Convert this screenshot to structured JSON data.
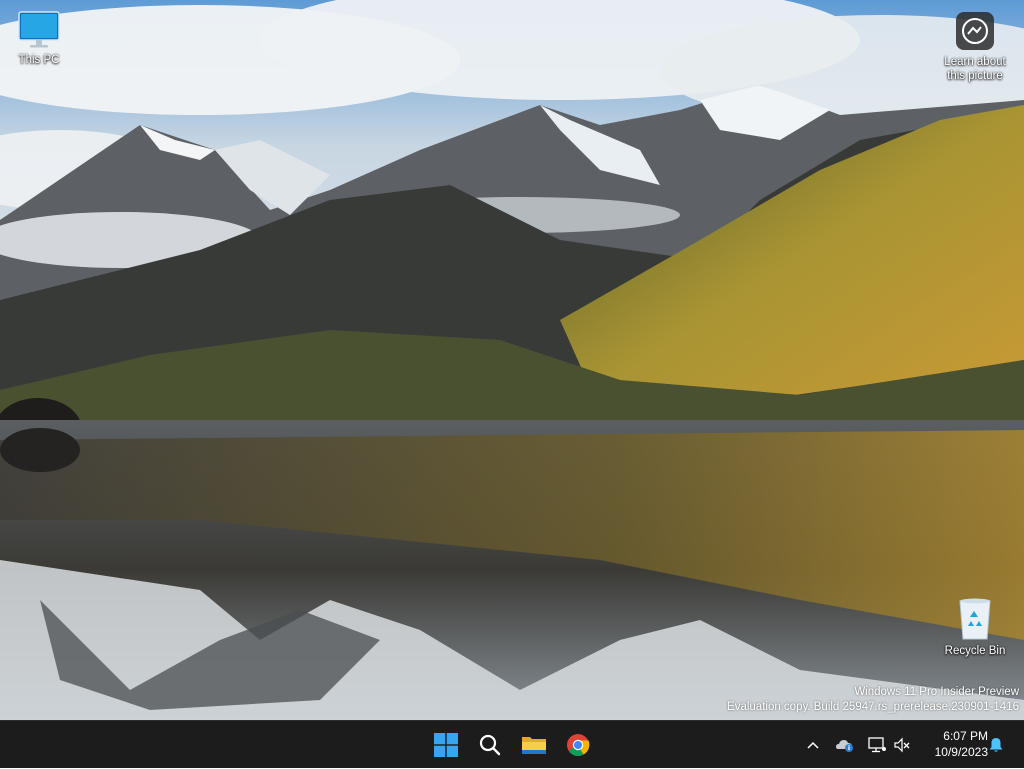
{
  "desktop": {
    "icons": [
      {
        "label": "This PC",
        "icon": "monitor-icon"
      },
      {
        "label_line1": "Learn about",
        "label_line2": "this picture",
        "icon": "camera-info-icon"
      },
      {
        "label": "Recycle Bin",
        "icon": "recycle-bin-icon"
      }
    ],
    "watermark": {
      "line1": "Windows 11 Pro Insider Preview",
      "line2": "Evaluation copy. Build 25947.rs_prerelease.230901-1416"
    }
  },
  "taskbar": {
    "apps": [
      {
        "icon": "windows-start-icon",
        "color": "#38a5f0"
      },
      {
        "icon": "search-icon",
        "color": "#ffffff"
      },
      {
        "icon": "file-explorer-icon",
        "color": "#f5c33b"
      },
      {
        "icon": "chrome-icon",
        "color": "#4285f4"
      }
    ],
    "tray": {
      "icons": [
        "chevron-up-icon",
        "onedrive-icon",
        "network-icon",
        "volume-muted-icon",
        "notification-bell-icon"
      ],
      "accent": "#4cc2ff"
    },
    "clock": {
      "time": "6:07 PM",
      "date": "10/9/2023"
    }
  }
}
